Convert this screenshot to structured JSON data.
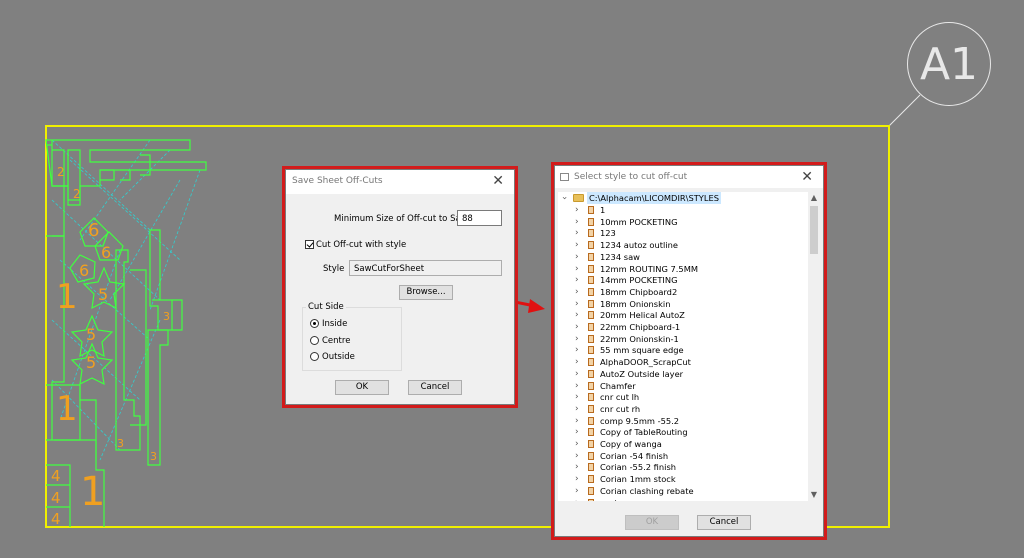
{
  "sheet": {
    "label": "A1",
    "part_numbers": [
      "2",
      "2",
      "6",
      "6",
      "6",
      "5",
      "5",
      "5",
      "1",
      "1",
      "1",
      "3",
      "3",
      "3",
      "4",
      "4",
      "4"
    ]
  },
  "save_dialog": {
    "title": "Save Sheet Off-Cuts",
    "min_size_label": "Minimum Size of Off-cut to Save:",
    "min_size_value": "88",
    "cut_with_style_label": "Cut Off-cut with style",
    "cut_with_style_checked": true,
    "style_label": "Style",
    "style_value": "SawCutForSheet",
    "browse_label": "Browse...",
    "cut_side_group": "Cut Side",
    "cut_side_options": [
      "Inside",
      "Centre",
      "Outside"
    ],
    "cut_side_selected": "Inside",
    "ok_label": "OK",
    "cancel_label": "Cancel"
  },
  "style_dialog": {
    "title": "Select style to cut off-cut",
    "root_path": "C:\\Alphacam\\LICOMDIR\\STYLES",
    "items": [
      "1",
      "10mm POCKETING",
      "123",
      "1234 autoz outline",
      "1234 saw",
      "12mm ROUTING 7.5MM",
      "14mm POCKETING",
      "18mm Chipboard2",
      "18mm Onionskin",
      "20mm Helical AutoZ",
      "22mm Chipboard-1",
      "22mm Onionskin-1",
      "55 mm square edge",
      "AlphaDOOR_ScrapCut",
      "AutoZ Outside layer",
      "Chamfer",
      "cnr cut lh",
      "cnr cut rh",
      "comp 9.5mm -55.2",
      "Copy of TableRouting",
      "Copy of wanga",
      "Corian -54 finish",
      "Corian -55.2 finish",
      "Corian 1mm stock",
      "Corian clashing rebate",
      "coving groove"
    ],
    "ok_label": "OK",
    "ok_enabled": false,
    "cancel_label": "Cancel"
  },
  "colors": {
    "background": "#808080",
    "sheet_outline": "#f0f000",
    "part_outline": "#40ff40",
    "toolpath": "#30d0d0",
    "part_number": "#f0a020",
    "highlight_border": "#d21b1b",
    "arrow": "#e01010"
  }
}
